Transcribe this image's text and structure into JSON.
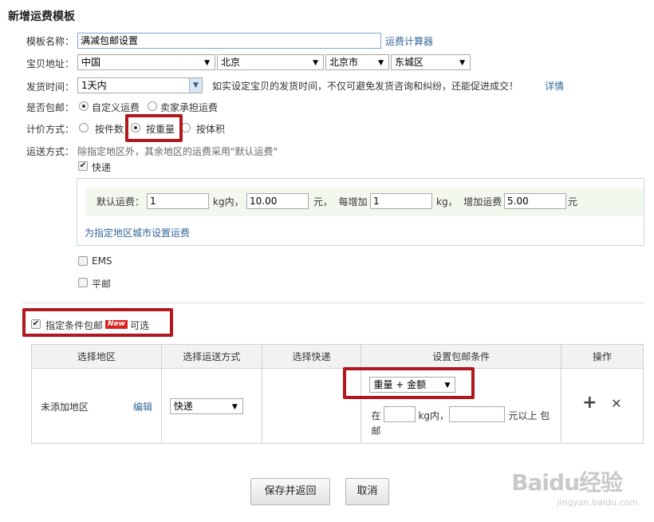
{
  "page_title": "新增运费模板",
  "template_name": {
    "label": "模板名称：",
    "value": "满减包邮设置",
    "calc_link": "运费计算器"
  },
  "address": {
    "label": "宝贝地址：",
    "country": "中国",
    "province": "北京",
    "city": "北京市",
    "district": "东城区"
  },
  "ship_time": {
    "label": "发货时间：",
    "value": "1天内",
    "hint": "如实设定宝贝的发货时间，不仅可避免发货咨询和纠纷，还能促进成交！",
    "detail_link": "详情"
  },
  "free_shipping": {
    "label": "是否包邮：",
    "opt1": "自定义运费",
    "opt2": "卖家承担运费"
  },
  "pricing": {
    "label": "计价方式：",
    "opt1": "按件数",
    "opt2": "按重量",
    "opt3": "按体积"
  },
  "shipping": {
    "label": "运送方式：",
    "desc": "除指定地区外，其余地区的运费采用\"默认运费\"",
    "express_label": "快递",
    "default_fee_label": "默认运费：",
    "first_weight": "1",
    "kg_within": "kg内，",
    "first_fee": "10.00",
    "yuan_each_add": "元，  每增加",
    "add_weight": "1",
    "kg_add_fee": "kg，  增加运费",
    "add_fee": "5.00",
    "yuan": "元",
    "region_link": "为指定地区城市设置运费",
    "ems_label": "EMS",
    "post_label": "平邮"
  },
  "conditional": {
    "label": "指定条件包邮",
    "badge": "New",
    "optional": "可选"
  },
  "table": {
    "headers": [
      "选择地区",
      "选择运送方式",
      "选择快递",
      "设置包邮条件",
      "操作"
    ],
    "row": {
      "region": "未添加地区",
      "edit": "编辑",
      "method": "快递",
      "condition": "重量 + 金额",
      "cond_prefix": "在",
      "cond_kg": "kg内，",
      "cond_yuan": "元以上 包",
      "cond_end": "邮",
      "add_icon": "+",
      "remove_icon": "✕"
    }
  },
  "buttons": {
    "save": "保存并返回",
    "cancel": "取消"
  },
  "watermark": {
    "logo": "Baidu经验",
    "url": "jingyan.baidu.com"
  }
}
